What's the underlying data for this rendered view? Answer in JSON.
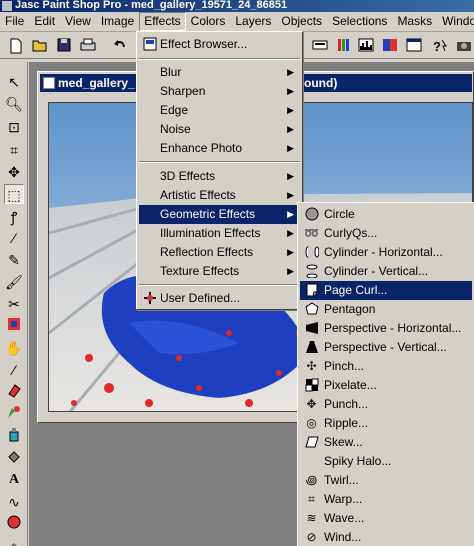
{
  "app": {
    "title": "Jasc Paint Shop Pro - med_gallery_19571_24_86851"
  },
  "menubar": [
    "File",
    "Edit",
    "View",
    "Image",
    "Effects",
    "Colors",
    "Layers",
    "Objects",
    "Selections",
    "Masks",
    "Window"
  ],
  "document": {
    "title": "med_gallery_",
    "title_tail": "ground)"
  },
  "effects_menu": {
    "browser": "Effect Browser...",
    "items": [
      "Blur",
      "Sharpen",
      "Edge",
      "Noise",
      "Enhance Photo",
      "3D Effects",
      "Artistic Effects",
      "Geometric Effects",
      "Illumination Effects",
      "Reflection Effects",
      "Texture Effects"
    ],
    "user_defined": "User Defined..."
  },
  "geometric_submenu": [
    "Circle",
    "CurlyQs...",
    "Cylinder - Horizontal...",
    "Cylinder - Vertical...",
    "Page Curl...",
    "Pentagon",
    "Perspective - Horizontal...",
    "Perspective - Vertical...",
    "Pinch...",
    "Pixelate...",
    "Punch...",
    "Ripple...",
    "Skew...",
    "Spiky Halo...",
    "Twirl...",
    "Warp...",
    "Wave...",
    "Wind..."
  ],
  "colors": {
    "highlight": "#0a246a",
    "menu_bg": "#d4d0c8",
    "workspace": "#808080"
  }
}
